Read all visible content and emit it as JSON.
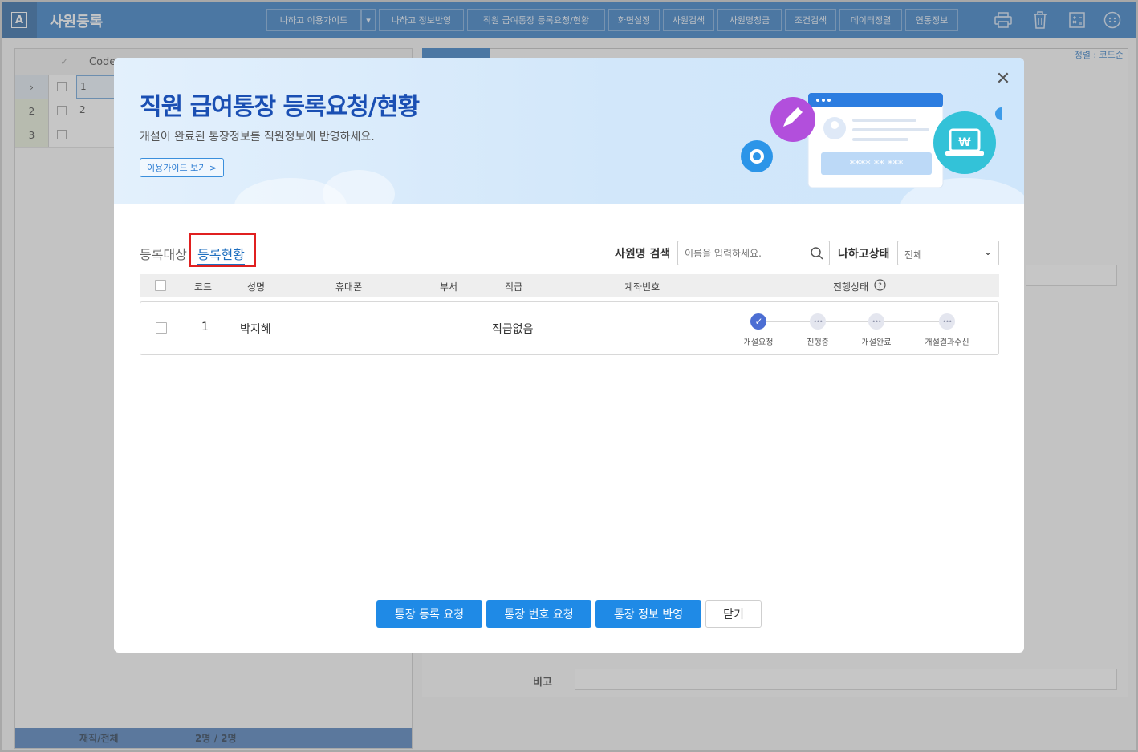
{
  "app": {
    "title": "사원등록",
    "toolbar": [
      {
        "label": "나하고 이용가이드"
      },
      {
        "label": "나하고 정보반영"
      },
      {
        "label": "직원 급여통장 등록요청/현황"
      },
      {
        "label": "화면설정"
      },
      {
        "label": "사원검색"
      },
      {
        "label": "사원명칭금"
      },
      {
        "label": "조건검색"
      },
      {
        "label": "데이터정렬"
      },
      {
        "label": "연동정보"
      }
    ],
    "icons": [
      "print-icon",
      "trash-icon",
      "calculator-icon",
      "more-icon"
    ]
  },
  "left_grid": {
    "header_code": "Code",
    "rows": [
      {
        "num": "",
        "code": "1"
      },
      {
        "num": "2",
        "code": "2"
      },
      {
        "num": "3",
        "code": ""
      }
    ],
    "footer_label": "재직/전체",
    "footer_value": "2명 / 2명"
  },
  "right_panel": {
    "sort_label": "정렬 : 코드순",
    "note_label": "비고"
  },
  "modal": {
    "title": "직원 급여통장 등록요청/현황",
    "subtitle": "개설이 완료된 통장정보를 직원정보에 반영하세요.",
    "guide_button": "이용가이드 보기 >",
    "tabs": {
      "target": "등록대상",
      "status": "등록현황"
    },
    "search": {
      "label": "사원명 검색",
      "placeholder": "이름을 입력하세요."
    },
    "filter": {
      "label": "나하고상태",
      "value": "전체"
    },
    "table": {
      "headers": {
        "code": "코드",
        "name": "성명",
        "phone": "휴대폰",
        "dept": "부서",
        "rank": "직급",
        "account": "계좌번호",
        "status": "진행상태"
      },
      "rows": [
        {
          "code": "1",
          "name": "박지혜",
          "phone": "",
          "dept": "",
          "rank": "직급없음",
          "account": "",
          "steps": [
            {
              "label": "개설요청",
              "done": true
            },
            {
              "label": "진행중",
              "done": false
            },
            {
              "label": "개설완료",
              "done": false
            },
            {
              "label": "개설결과수신",
              "done": false
            }
          ]
        }
      ]
    },
    "buttons": {
      "request_register": "통장 등록 요청",
      "request_number": "통장 번호 요청",
      "apply_info": "통장 정보 반영",
      "close": "닫기"
    }
  }
}
